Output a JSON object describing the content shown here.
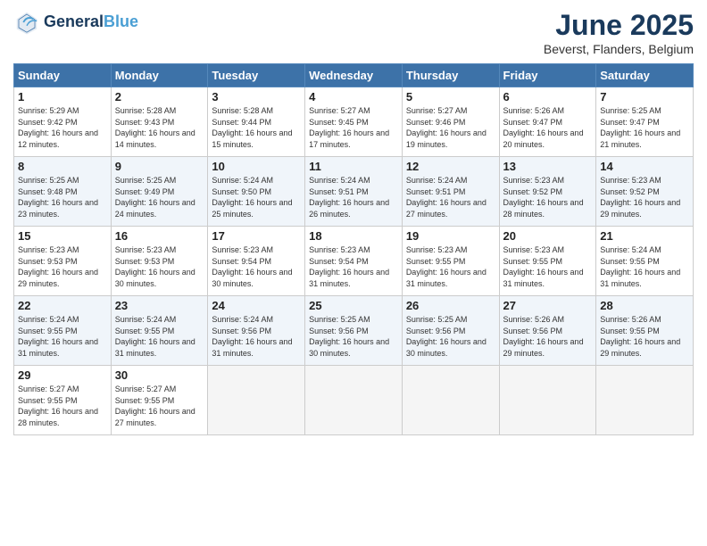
{
  "header": {
    "logo_line1": "General",
    "logo_line2": "Blue",
    "month_title": "June 2025",
    "location": "Beverst, Flanders, Belgium"
  },
  "weekdays": [
    "Sunday",
    "Monday",
    "Tuesday",
    "Wednesday",
    "Thursday",
    "Friday",
    "Saturday"
  ],
  "weeks": [
    [
      {
        "day": "1",
        "sunrise": "5:29 AM",
        "sunset": "9:42 PM",
        "daylight": "16 hours and 12 minutes."
      },
      {
        "day": "2",
        "sunrise": "5:28 AM",
        "sunset": "9:43 PM",
        "daylight": "16 hours and 14 minutes."
      },
      {
        "day": "3",
        "sunrise": "5:28 AM",
        "sunset": "9:44 PM",
        "daylight": "16 hours and 15 minutes."
      },
      {
        "day": "4",
        "sunrise": "5:27 AM",
        "sunset": "9:45 PM",
        "daylight": "16 hours and 17 minutes."
      },
      {
        "day": "5",
        "sunrise": "5:27 AM",
        "sunset": "9:46 PM",
        "daylight": "16 hours and 19 minutes."
      },
      {
        "day": "6",
        "sunrise": "5:26 AM",
        "sunset": "9:47 PM",
        "daylight": "16 hours and 20 minutes."
      },
      {
        "day": "7",
        "sunrise": "5:25 AM",
        "sunset": "9:47 PM",
        "daylight": "16 hours and 21 minutes."
      }
    ],
    [
      {
        "day": "8",
        "sunrise": "5:25 AM",
        "sunset": "9:48 PM",
        "daylight": "16 hours and 23 minutes."
      },
      {
        "day": "9",
        "sunrise": "5:25 AM",
        "sunset": "9:49 PM",
        "daylight": "16 hours and 24 minutes."
      },
      {
        "day": "10",
        "sunrise": "5:24 AM",
        "sunset": "9:50 PM",
        "daylight": "16 hours and 25 minutes."
      },
      {
        "day": "11",
        "sunrise": "5:24 AM",
        "sunset": "9:51 PM",
        "daylight": "16 hours and 26 minutes."
      },
      {
        "day": "12",
        "sunrise": "5:24 AM",
        "sunset": "9:51 PM",
        "daylight": "16 hours and 27 minutes."
      },
      {
        "day": "13",
        "sunrise": "5:23 AM",
        "sunset": "9:52 PM",
        "daylight": "16 hours and 28 minutes."
      },
      {
        "day": "14",
        "sunrise": "5:23 AM",
        "sunset": "9:52 PM",
        "daylight": "16 hours and 29 minutes."
      }
    ],
    [
      {
        "day": "15",
        "sunrise": "5:23 AM",
        "sunset": "9:53 PM",
        "daylight": "16 hours and 29 minutes."
      },
      {
        "day": "16",
        "sunrise": "5:23 AM",
        "sunset": "9:53 PM",
        "daylight": "16 hours and 30 minutes."
      },
      {
        "day": "17",
        "sunrise": "5:23 AM",
        "sunset": "9:54 PM",
        "daylight": "16 hours and 30 minutes."
      },
      {
        "day": "18",
        "sunrise": "5:23 AM",
        "sunset": "9:54 PM",
        "daylight": "16 hours and 31 minutes."
      },
      {
        "day": "19",
        "sunrise": "5:23 AM",
        "sunset": "9:55 PM",
        "daylight": "16 hours and 31 minutes."
      },
      {
        "day": "20",
        "sunrise": "5:23 AM",
        "sunset": "9:55 PM",
        "daylight": "16 hours and 31 minutes."
      },
      {
        "day": "21",
        "sunrise": "5:24 AM",
        "sunset": "9:55 PM",
        "daylight": "16 hours and 31 minutes."
      }
    ],
    [
      {
        "day": "22",
        "sunrise": "5:24 AM",
        "sunset": "9:55 PM",
        "daylight": "16 hours and 31 minutes."
      },
      {
        "day": "23",
        "sunrise": "5:24 AM",
        "sunset": "9:55 PM",
        "daylight": "16 hours and 31 minutes."
      },
      {
        "day": "24",
        "sunrise": "5:24 AM",
        "sunset": "9:56 PM",
        "daylight": "16 hours and 31 minutes."
      },
      {
        "day": "25",
        "sunrise": "5:25 AM",
        "sunset": "9:56 PM",
        "daylight": "16 hours and 30 minutes."
      },
      {
        "day": "26",
        "sunrise": "5:25 AM",
        "sunset": "9:56 PM",
        "daylight": "16 hours and 30 minutes."
      },
      {
        "day": "27",
        "sunrise": "5:26 AM",
        "sunset": "9:56 PM",
        "daylight": "16 hours and 29 minutes."
      },
      {
        "day": "28",
        "sunrise": "5:26 AM",
        "sunset": "9:55 PM",
        "daylight": "16 hours and 29 minutes."
      }
    ],
    [
      {
        "day": "29",
        "sunrise": "5:27 AM",
        "sunset": "9:55 PM",
        "daylight": "16 hours and 28 minutes."
      },
      {
        "day": "30",
        "sunrise": "5:27 AM",
        "sunset": "9:55 PM",
        "daylight": "16 hours and 27 minutes."
      },
      null,
      null,
      null,
      null,
      null
    ]
  ]
}
